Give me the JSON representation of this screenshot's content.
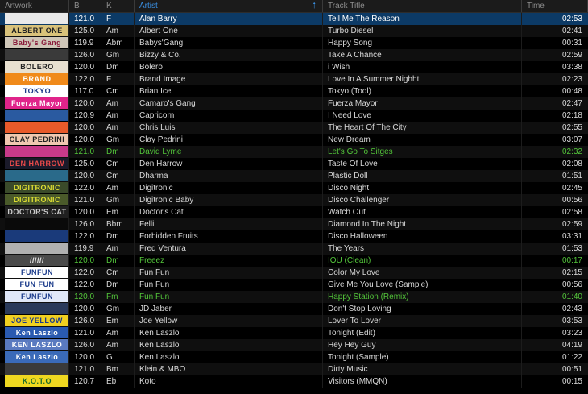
{
  "header": {
    "artwork": "Artwork",
    "bpm": "B",
    "key": "K",
    "artist": "Artist",
    "title": "Track Title",
    "time": "Time",
    "sort_icon": "sort-ascending-arrow-icon"
  },
  "tracks": [
    {
      "bpm": "121.0",
      "key": "F",
      "artist": "Alan Barry",
      "title": "Tell Me The Reason",
      "time": "02:53",
      "state": "selected",
      "art_bg": "#e9e9e9",
      "art_fg": "#333",
      "art_text": ""
    },
    {
      "bpm": "125.0",
      "key": "Am",
      "artist": "Albert One",
      "title": "Turbo Diesel",
      "time": "02:41",
      "state": "",
      "art_bg": "#d9c27a",
      "art_fg": "#222",
      "art_text": "ALBERT ONE"
    },
    {
      "bpm": "119.9",
      "key": "Abm",
      "artist": "Babys'Gang",
      "title": "Happy Song",
      "time": "00:31",
      "state": "",
      "art_bg": "#cfc6b8",
      "art_fg": "#8a1a3a",
      "art_text": "Baby's Gang"
    },
    {
      "bpm": "126.0",
      "key": "Gm",
      "artist": "Bizzy & Co.",
      "title": "Take A Chance",
      "time": "02:59",
      "state": "",
      "art_bg": "#3a3a3a",
      "art_fg": "#bbb",
      "art_text": ""
    },
    {
      "bpm": "120.0",
      "key": "Dm",
      "artist": "Bolero",
      "title": "i Wish",
      "time": "03:38",
      "state": "",
      "art_bg": "#e8e0d0",
      "art_fg": "#222",
      "art_text": "BOLERO"
    },
    {
      "bpm": "122.0",
      "key": "F",
      "artist": "Brand Image",
      "title": "Love In A Summer Nighht",
      "time": "02:23",
      "state": "",
      "art_bg": "#f08a1a",
      "art_fg": "#fff",
      "art_text": "BRAND"
    },
    {
      "bpm": "117.0",
      "key": "Cm",
      "artist": "Brian Ice",
      "title": "Tokyo (Tool)",
      "time": "00:48",
      "state": "",
      "art_bg": "#ffffff",
      "art_fg": "#1a3a8a",
      "art_text": "TOKYO"
    },
    {
      "bpm": "120.0",
      "key": "Am",
      "artist": "Camaro's Gang",
      "title": "Fuerza Mayor",
      "time": "02:47",
      "state": "",
      "art_bg": "#e0248a",
      "art_fg": "#fff",
      "art_text": "Fuerza Mayor"
    },
    {
      "bpm": "120.9",
      "key": "Am",
      "artist": "Capricorn",
      "title": "I Need Love",
      "time": "02:18",
      "state": "",
      "art_bg": "#2a5aa0",
      "art_fg": "#fff",
      "art_text": ""
    },
    {
      "bpm": "120.0",
      "key": "Am",
      "artist": "Chris Luis",
      "title": "The Heart Of The City",
      "time": "02:55",
      "state": "",
      "art_bg": "#e85a2a",
      "art_fg": "#fff",
      "art_text": ""
    },
    {
      "bpm": "120.0",
      "key": "Gm",
      "artist": "Clay Pedrini",
      "title": "New Dream",
      "time": "03:07",
      "state": "",
      "art_bg": "#f0c8b0",
      "art_fg": "#222",
      "art_text": "CLAY PEDRINI"
    },
    {
      "bpm": "121.0",
      "key": "Dm",
      "artist": "David Lyme",
      "title": "Let's Go To Sitges",
      "time": "02:32",
      "state": "played",
      "art_bg": "#c83a8a",
      "art_fg": "#fff",
      "art_text": ""
    },
    {
      "bpm": "125.0",
      "key": "Cm",
      "artist": "Den Harrow",
      "title": "Taste Of Love",
      "time": "02:08",
      "state": "",
      "art_bg": "#1a1a2a",
      "art_fg": "#e84a4a",
      "art_text": "DEN HARROW"
    },
    {
      "bpm": "120.0",
      "key": "Cm",
      "artist": "Dharma",
      "title": "Plastic Doll",
      "time": "01:51",
      "state": "",
      "art_bg": "#2a6a8a",
      "art_fg": "#fff",
      "art_text": ""
    },
    {
      "bpm": "122.0",
      "key": "Am",
      "artist": "Digitronic",
      "title": "Disco Night",
      "time": "02:45",
      "state": "",
      "art_bg": "#3a4a2a",
      "art_fg": "#dd3",
      "art_text": "DIGITRONIC"
    },
    {
      "bpm": "121.0",
      "key": "Gm",
      "artist": "Digitronic Baby",
      "title": "Disco Challenger",
      "time": "00:56",
      "state": "",
      "art_bg": "#4a5a2a",
      "art_fg": "#dd3",
      "art_text": "DIGITRONIC"
    },
    {
      "bpm": "120.0",
      "key": "Em",
      "artist": "Doctor's Cat",
      "title": "Watch Out",
      "time": "02:58",
      "state": "",
      "art_bg": "#202020",
      "art_fg": "#ccc",
      "art_text": "DOCTOR'S CAT"
    },
    {
      "bpm": "126.0",
      "key": "Bbm",
      "artist": "Felli",
      "title": "Diamond In The Night",
      "time": "02:59",
      "state": "",
      "art_bg": "#0a0a0a",
      "art_fg": "#777",
      "art_text": ""
    },
    {
      "bpm": "122.0",
      "key": "Dm",
      "artist": "Forbidden Fruits",
      "title": "Disco Halloween",
      "time": "03:31",
      "state": "",
      "art_bg": "#1a3a7a",
      "art_fg": "#fff",
      "art_text": ""
    },
    {
      "bpm": "119.9",
      "key": "Am",
      "artist": "Fred Ventura",
      "title": "The Years",
      "time": "01:53",
      "state": "",
      "art_bg": "#b0b0b0",
      "art_fg": "#222",
      "art_text": ""
    },
    {
      "bpm": "120.0",
      "key": "Dm",
      "artist": "Freeez",
      "title": "IOU (Clean)",
      "time": "00:17",
      "state": "played",
      "art_bg": "#4a4a4a",
      "art_fg": "#eee",
      "art_text": "//////"
    },
    {
      "bpm": "122.0",
      "key": "Cm",
      "artist": "Fun Fun",
      "title": "Color My Love",
      "time": "02:15",
      "state": "",
      "art_bg": "#ffffff",
      "art_fg": "#1a3a8a",
      "art_text": "FUNFUN"
    },
    {
      "bpm": "122.0",
      "key": "Dm",
      "artist": "Fun Fun",
      "title": "Give Me You Love (Sample)",
      "time": "00:56",
      "state": "",
      "art_bg": "#ffffff",
      "art_fg": "#1a3a8a",
      "art_text": "FUN FUN"
    },
    {
      "bpm": "120.0",
      "key": "Fm",
      "artist": "Fun Fun",
      "title": "Happy Station (Remix)",
      "time": "01:40",
      "state": "played",
      "art_bg": "#e0e8f8",
      "art_fg": "#1a3a8a",
      "art_text": "FUNFUN"
    },
    {
      "bpm": "120.0",
      "key": "Gm",
      "artist": "JD Jaber",
      "title": "Don't Stop Loving",
      "time": "02:43",
      "state": "",
      "art_bg": "#2a3a5a",
      "art_fg": "#fff",
      "art_text": ""
    },
    {
      "bpm": "126.0",
      "key": "Em",
      "artist": "Joe Yellow",
      "title": "Lover To Lover",
      "time": "03:53",
      "state": "",
      "art_bg": "#f0d020",
      "art_fg": "#1a3a8a",
      "art_text": "JOE YELLOW"
    },
    {
      "bpm": "121.0",
      "key": "Am",
      "artist": "Ken Laszlo",
      "title": "Tonight (Edit)",
      "time": "03:23",
      "state": "",
      "art_bg": "#2a5ab0",
      "art_fg": "#fff",
      "art_text": "Ken Laszlo"
    },
    {
      "bpm": "126.0",
      "key": "Am",
      "artist": "Ken Laszlo",
      "title": "Hey Hey Guy",
      "time": "04:19",
      "state": "",
      "art_bg": "#5a7ac0",
      "art_fg": "#fff",
      "art_text": "KEN LASZLO"
    },
    {
      "bpm": "120.0",
      "key": "G",
      "artist": "Ken Laszlo",
      "title": "Tonight (Sample)",
      "time": "01:22",
      "state": "",
      "art_bg": "#3a6ab8",
      "art_fg": "#fff",
      "art_text": "Ken Laszlo"
    },
    {
      "bpm": "121.0",
      "key": "Bm",
      "artist": "Klein & MBO",
      "title": "Dirty Music",
      "time": "00:51",
      "state": "",
      "art_bg": "#3a3a3a",
      "art_fg": "#eee",
      "art_text": ""
    },
    {
      "bpm": "120.7",
      "key": "Eb",
      "artist": "Koto",
      "title": "Visitors (MMQN)",
      "time": "00:15",
      "state": "",
      "art_bg": "#f0d820",
      "art_fg": "#1a6a2a",
      "art_text": "K.O.T.O"
    }
  ]
}
